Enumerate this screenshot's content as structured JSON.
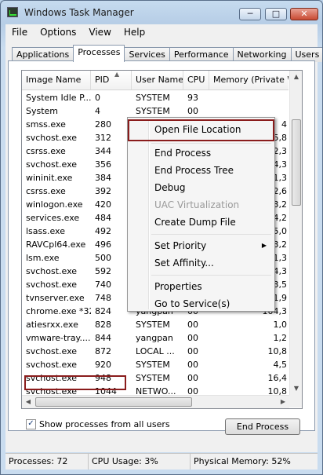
{
  "window": {
    "title": "Windows Task Manager"
  },
  "title_controls": {
    "minimize": "─",
    "maximize": "□",
    "close": "✕"
  },
  "menu": [
    "File",
    "Options",
    "View",
    "Help"
  ],
  "tabs": [
    "Applications",
    "Processes",
    "Services",
    "Performance",
    "Networking",
    "Users"
  ],
  "active_tab": "Processes",
  "columns": [
    "Image Name",
    "PID",
    "User Name",
    "CPU",
    "Memory (Private W"
  ],
  "processes": [
    {
      "name": "System Idle P...",
      "pid": "0",
      "user": "SYSTEM",
      "cpu": "93",
      "mem": ""
    },
    {
      "name": "System",
      "pid": "4",
      "user": "SYSTEM",
      "cpu": "00",
      "mem": ""
    },
    {
      "name": "smss.exe",
      "pid": "280",
      "user": "SYSTEM",
      "cpu": "00",
      "mem": "4"
    },
    {
      "name": "svchost.exe",
      "pid": "312",
      "user": "",
      "cpu": "",
      "mem": "5,8"
    },
    {
      "name": "csrss.exe",
      "pid": "344",
      "user": "",
      "cpu": "",
      "mem": "2,3"
    },
    {
      "name": "svchost.exe",
      "pid": "356",
      "user": "",
      "cpu": "",
      "mem": "4,3"
    },
    {
      "name": "wininit.exe",
      "pid": "384",
      "user": "",
      "cpu": "",
      "mem": "1,3"
    },
    {
      "name": "csrss.exe",
      "pid": "392",
      "user": "",
      "cpu": "",
      "mem": "2,6"
    },
    {
      "name": "winlogon.exe",
      "pid": "420",
      "user": "",
      "cpu": "",
      "mem": "3,2"
    },
    {
      "name": "services.exe",
      "pid": "484",
      "user": "",
      "cpu": "",
      "mem": "4,2"
    },
    {
      "name": "lsass.exe",
      "pid": "492",
      "user": "",
      "cpu": "",
      "mem": "5,0"
    },
    {
      "name": "RAVCpl64.exe",
      "pid": "496",
      "user": "",
      "cpu": "",
      "mem": "3,2"
    },
    {
      "name": "lsm.exe",
      "pid": "500",
      "user": "",
      "cpu": "",
      "mem": "1,3"
    },
    {
      "name": "svchost.exe",
      "pid": "592",
      "user": "",
      "cpu": "",
      "mem": "4,3"
    },
    {
      "name": "svchost.exe",
      "pid": "740",
      "user": "",
      "cpu": "",
      "mem": "3,5"
    },
    {
      "name": "tvnserver.exe",
      "pid": "748",
      "user": "",
      "cpu": "",
      "mem": "1,9"
    },
    {
      "name": "chrome.exe *32",
      "pid": "824",
      "user": "yangpan",
      "cpu": "00",
      "mem": "104,3"
    },
    {
      "name": "atiesrxx.exe",
      "pid": "828",
      "user": "SYSTEM",
      "cpu": "00",
      "mem": "1,0"
    },
    {
      "name": "vmware-tray....",
      "pid": "844",
      "user": "yangpan",
      "cpu": "00",
      "mem": "1,2"
    },
    {
      "name": "svchost.exe",
      "pid": "872",
      "user": "LOCAL ...",
      "cpu": "00",
      "mem": "10,8"
    },
    {
      "name": "svchost.exe",
      "pid": "920",
      "user": "SYSTEM",
      "cpu": "00",
      "mem": "4,5"
    },
    {
      "name": "svchost.exe",
      "pid": "948",
      "user": "SYSTEM",
      "cpu": "00",
      "mem": "16,4"
    },
    {
      "name": "svchost.exe",
      "pid": "1044",
      "user": "NETWO...",
      "cpu": "00",
      "mem": "10,8"
    }
  ],
  "context_menu": {
    "open_file_location": "Open File Location",
    "end_process": "End Process",
    "end_process_tree": "End Process Tree",
    "debug": "Debug",
    "uac_virtualization": "UAC Virtualization",
    "create_dump_file": "Create Dump File",
    "set_priority": "Set Priority",
    "set_affinity": "Set Affinity...",
    "properties": "Properties",
    "go_to_services": "Go to Service(s)"
  },
  "show_all_processes": {
    "label": "Show processes from all users",
    "checked": true,
    "mark": "✓"
  },
  "end_process_button": "End Process",
  "status": {
    "processes": "Processes: 72",
    "cpu_usage": "CPU Usage: 3%",
    "physical_memory": "Physical Memory: 52%"
  },
  "colors": {
    "highlight_border": "#8a1c1c"
  }
}
